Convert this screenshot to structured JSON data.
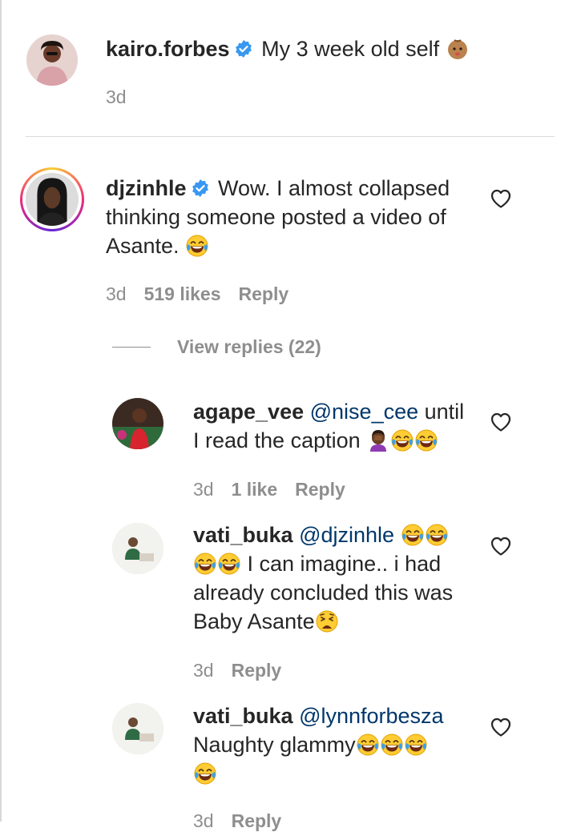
{
  "caption": {
    "username": "kairo.forbes",
    "text": "My 3 week old self",
    "time": "3d"
  },
  "comment": {
    "username": "djzinhle",
    "text_line1": "Wow. I almost collapsed",
    "text_line2": "thinking someone posted a video of",
    "text_line3": "Asante.",
    "time": "3d",
    "likes": "519 likes",
    "reply": "Reply",
    "view_replies": "View replies (22)"
  },
  "replies": [
    {
      "username": "agape_vee",
      "mention": "@nise_cee",
      "text1": "until",
      "text2": "I read the caption",
      "time": "3d",
      "likes": "1 like",
      "reply": "Reply"
    },
    {
      "username": "vati_buka",
      "mention": "@djzinhle",
      "text2": "I can imagine.. i had",
      "text3": "already concluded this was",
      "text4": "Baby Asante",
      "time": "3d",
      "reply": "Reply"
    },
    {
      "username": "vati_buka",
      "mention": "@lynnforbesza",
      "text2": "Naughty glammy",
      "time": "3d",
      "reply": "Reply"
    }
  ],
  "icons": {
    "verified": "verified-badge-icon",
    "heart": "heart-outline-icon",
    "laugh": "face-with-tears-of-joy-emoji",
    "baby": "baby-emoji",
    "facepalm": "facepalm-emoji",
    "weary": "weary-face-emoji"
  },
  "colors": {
    "text": "#262626",
    "secondary": "#8e8e8e",
    "mention": "#00376b",
    "verified": "#3897f0",
    "divider": "#dbdbdb"
  }
}
